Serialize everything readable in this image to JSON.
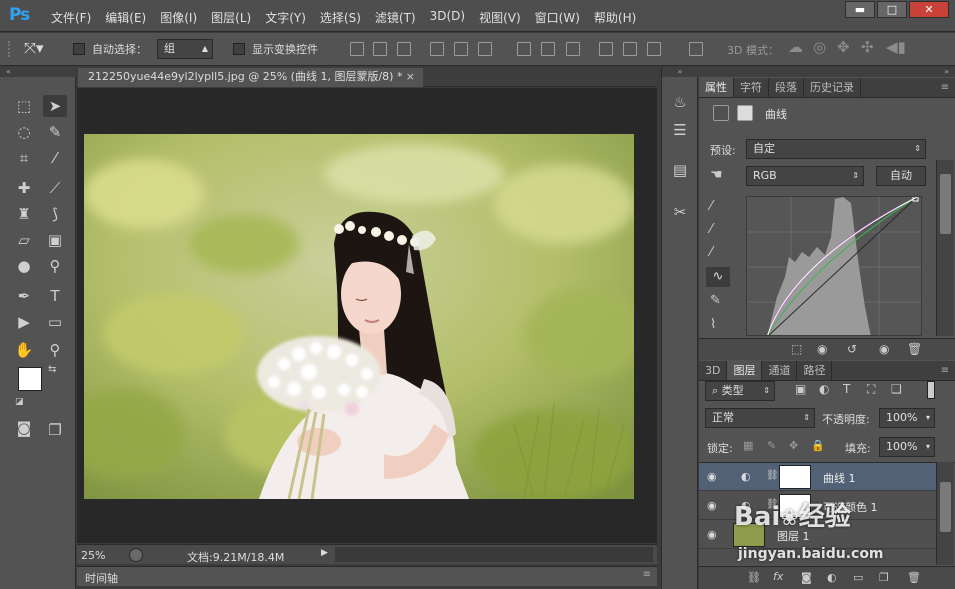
{
  "app": {
    "logo": "Ps"
  },
  "menu": [
    "文件(F)",
    "编辑(E)",
    "图像(I)",
    "图层(L)",
    "文字(Y)",
    "选择(S)",
    "滤镜(T)",
    "3D(D)",
    "视图(V)",
    "窗口(W)",
    "帮助(H)"
  ],
  "window_buttons": {
    "minimize": "▬",
    "maximize": "□",
    "close": "✕"
  },
  "options": {
    "auto_select_label": "自动选择：",
    "auto_select_value": "组",
    "show_transform_label": "显示变换控件",
    "mode_3d_label": "3D 模式："
  },
  "document": {
    "tab_title": "212250yue44e9yl2lypll5.jpg @ 25% (曲线 1, 图层蒙版/8) *",
    "tab_close": "×",
    "zoom": "25%",
    "doc_size": "文档:9.21M/18.4M",
    "timeline_label": "时间轴"
  },
  "properties": {
    "tabs": [
      "属性",
      "字符",
      "段落",
      "历史记录"
    ],
    "panel_title": "曲线",
    "preset_label": "预设:",
    "preset_value": "自定",
    "channel_value": "RGB",
    "auto_button": "自动"
  },
  "layers": {
    "tabs": [
      "3D",
      "图层",
      "通道",
      "路径"
    ],
    "filter_type": "类型",
    "blend_mode": "正常",
    "opacity_label": "不透明度:",
    "opacity_value": "100%",
    "lock_label": "锁定:",
    "fill_label": "填充:",
    "fill_value": "100%",
    "rows": [
      {
        "name": "曲线 1"
      },
      {
        "name": "可选颜色 1"
      },
      {
        "name": "图层 1"
      }
    ]
  },
  "watermark": {
    "line1": "Bai",
    "line2": "经验",
    "url": "jingyan.baidu.com"
  },
  "colors": {
    "accent": "#2fa3f2",
    "selected_layer": "#526175"
  }
}
